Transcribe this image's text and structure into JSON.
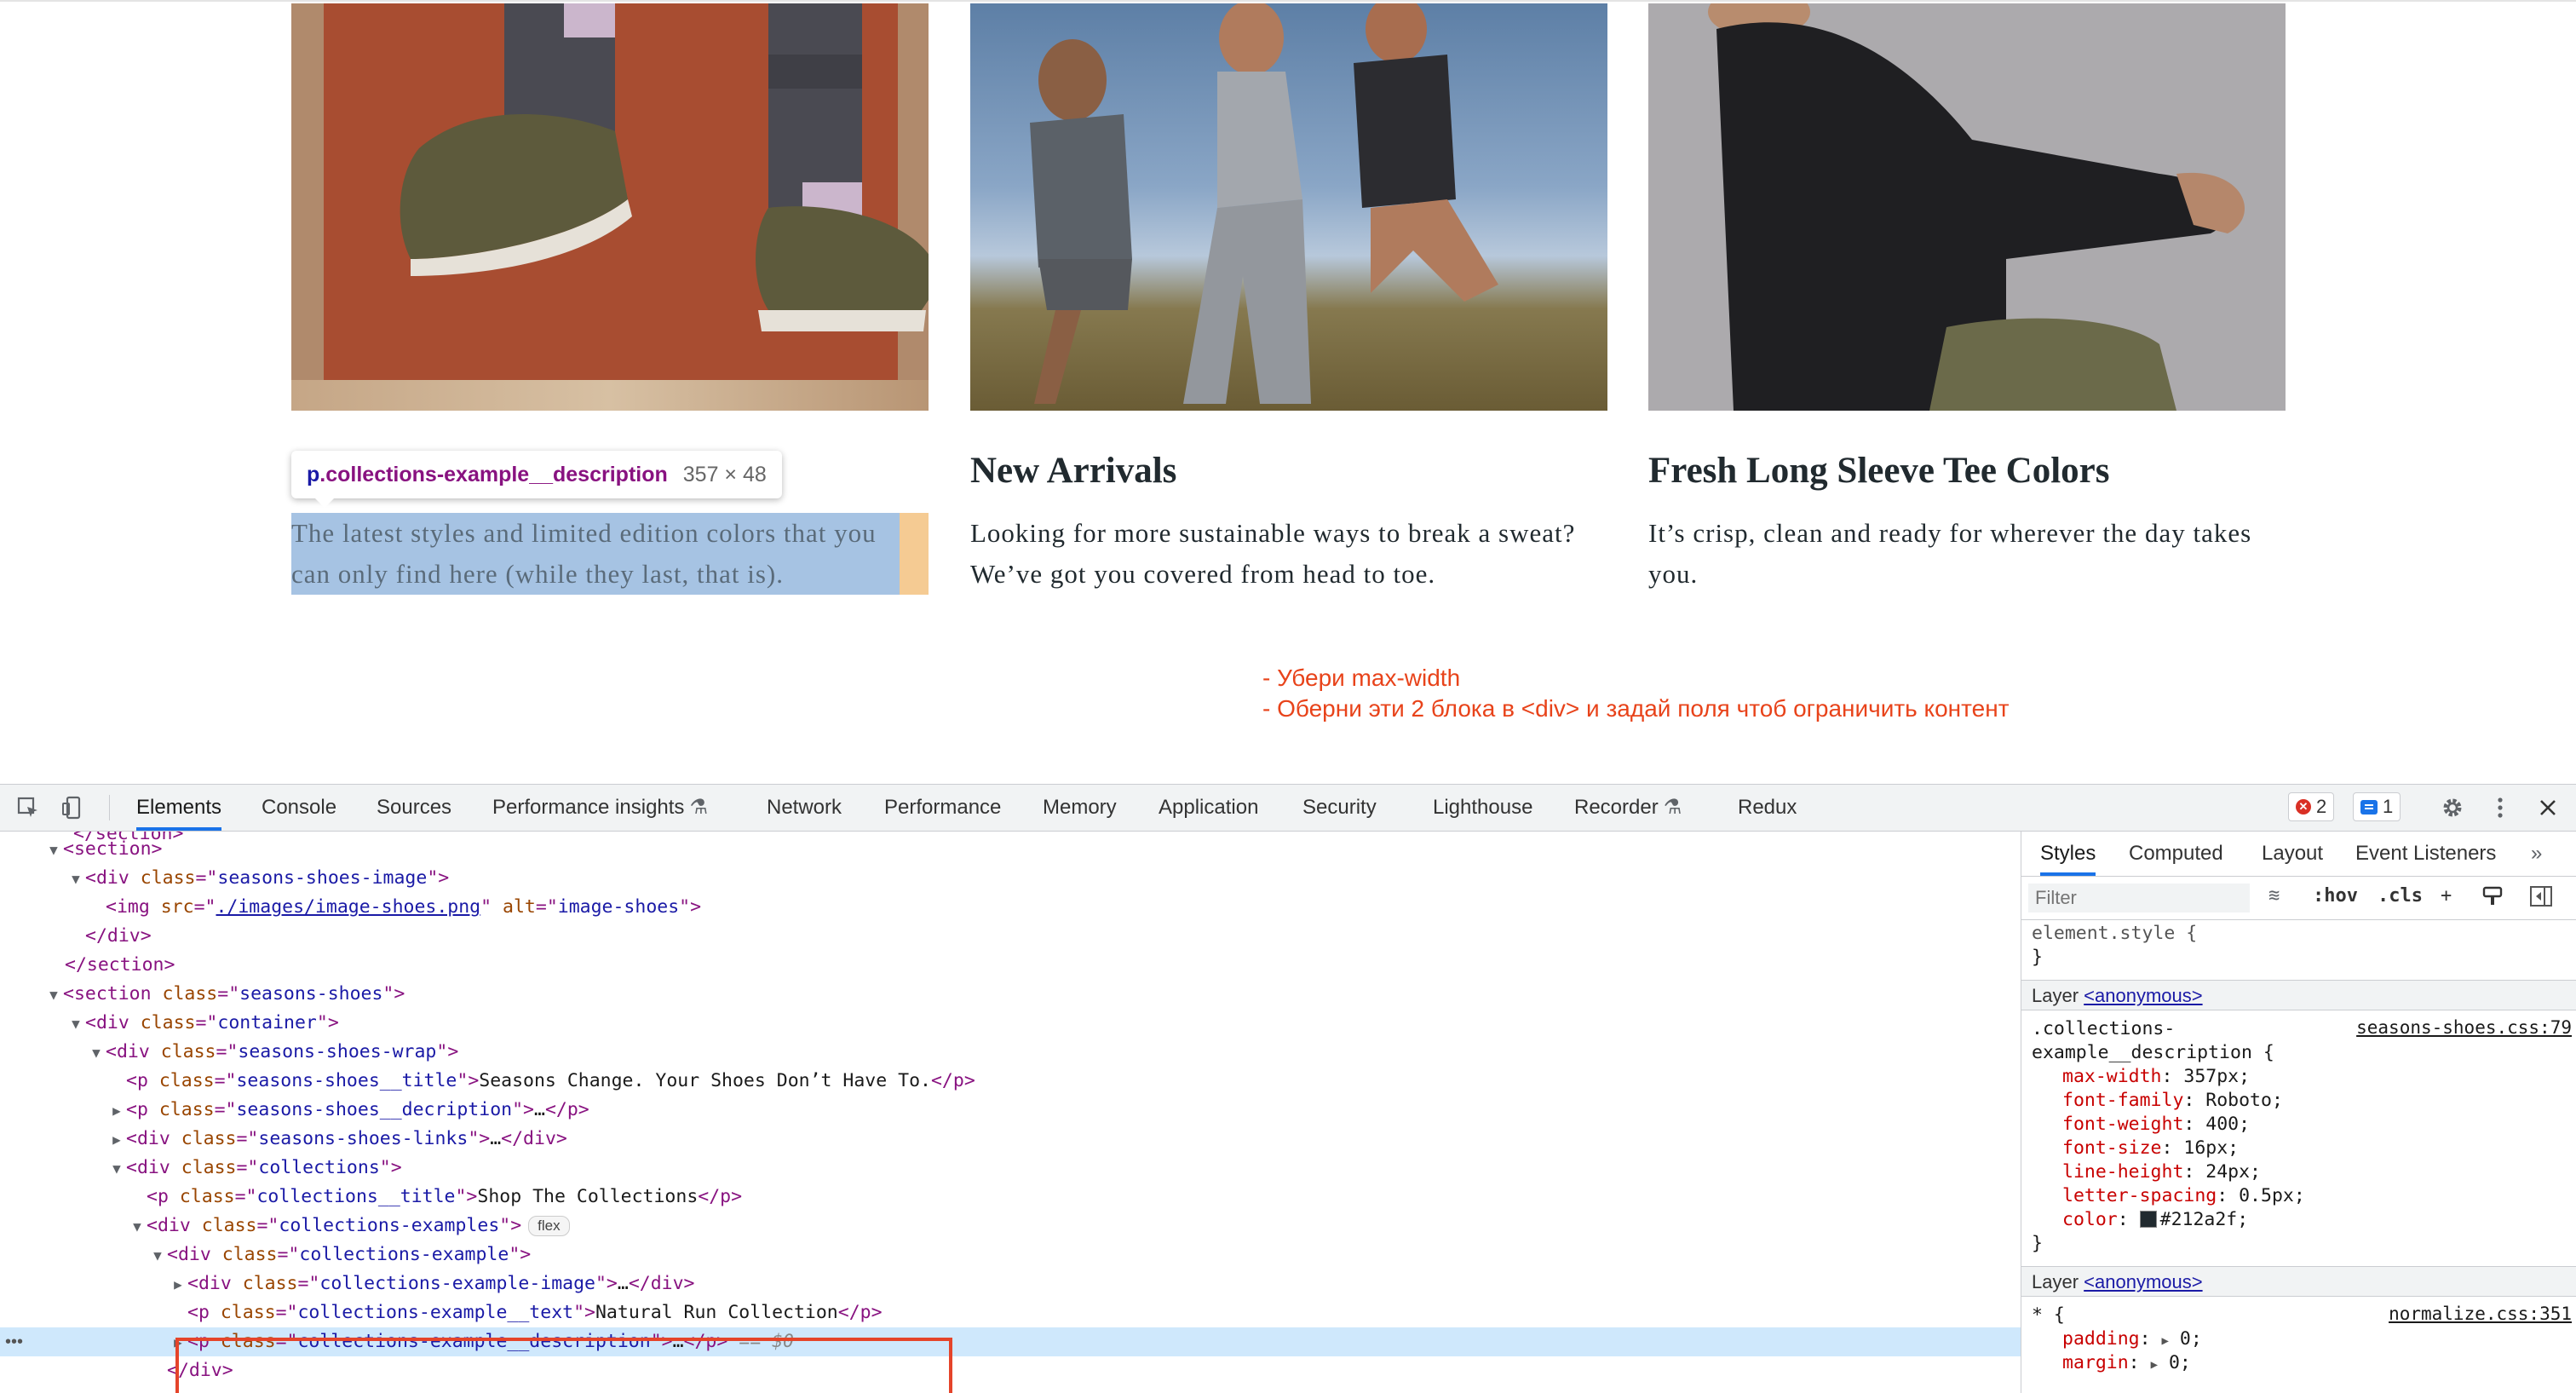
{
  "page": {
    "cards": [
      {
        "image_alt": "Natural Run Collection shoes image",
        "title": "",
        "description": "The latest styles and limited edition colors that you can only find here (while they last, that is)."
      },
      {
        "image_alt": "runners image",
        "title": "New Arrivals",
        "description": "Looking for more sustainable ways to break a sweat? We’ve got you covered from head to toe."
      },
      {
        "image_alt": "long sleeve tee image",
        "title": "Fresh Long Sleeve Tee Colors",
        "description": "It’s crisp, clean and ready for wherever the day takes you."
      }
    ],
    "tooltip": {
      "selector_tag": "p",
      "selector_class": ".collections-example__description",
      "size": "357 × 48"
    },
    "notes": [
      "- Убери max-width",
      "- Оберни эти 2 блока в <div> и задай поля чтоб ограничить контент"
    ]
  },
  "devtools": {
    "tabs": [
      "Elements",
      "Console",
      "Sources",
      "Performance insights",
      "Network",
      "Performance",
      "Memory",
      "Application",
      "Security",
      "Lighthouse",
      "Recorder",
      "Redux"
    ],
    "active_tab": "Elements",
    "error_count": "2",
    "message_count": "1",
    "dom": {
      "l0": "</section>",
      "l1": "<section>",
      "l2": {
        "tag": "div",
        "attr": "class",
        "val": "seasons-shoes-image"
      },
      "l3": {
        "attr1": "src",
        "val1": "./images/image-shoes.png",
        "attr2": "alt",
        "val2": "image-shoes"
      },
      "l4": "</div>",
      "l5": "</section>",
      "l6": {
        "tag": "section",
        "attr": "class",
        "val": "seasons-shoes"
      },
      "l7": {
        "tag": "div",
        "attr": "class",
        "val": "container"
      },
      "l8": {
        "tag": "div",
        "attr": "class",
        "val": "seasons-shoes-wrap"
      },
      "l9": {
        "tag": "p",
        "attr": "class",
        "val": "seasons-shoes__title",
        "text": "Seasons Change. Your Shoes Don’t Have To."
      },
      "l10": {
        "tag": "p",
        "attr": "class",
        "val": "seasons-shoes__decription"
      },
      "l11": {
        "tag": "div",
        "attr": "class",
        "val": "seasons-shoes-links"
      },
      "l12": {
        "tag": "div",
        "attr": "class",
        "val": "collections"
      },
      "l13": {
        "tag": "p",
        "attr": "class",
        "val": "collections__title",
        "text": "Shop The Collections"
      },
      "l14": {
        "tag": "div",
        "attr": "class",
        "val": "collections-examples",
        "badge": "flex"
      },
      "l15": {
        "tag": "div",
        "attr": "class",
        "val": "collections-example"
      },
      "l16": {
        "tag": "div",
        "attr": "class",
        "val": "collections-example-image"
      },
      "l17": {
        "tag": "p",
        "attr": "class",
        "val": "collections-example__text",
        "text": "Natural Run Collection"
      },
      "l18": {
        "tag": "p",
        "attr": "class",
        "val": "collections-example__description",
        "marker": "== $0"
      },
      "l19": "</div>",
      "ellipsis": "…"
    },
    "styles": {
      "tabs": [
        "Styles",
        "Computed",
        "Layout",
        "Event Listeners"
      ],
      "active_tab": "Styles",
      "filter_placeholder": "Filter",
      "hov": ":hov",
      "cls": ".cls",
      "element_style": "element.style {",
      "close_brace": "}",
      "layer_label": "Layer",
      "layer_name": "<anonymous>",
      "rule1": {
        "selector_line1": ".collections-",
        "selector_line2": "example__description {",
        "source": "seasons-shoes.css:79",
        "props": [
          {
            "name": "max-width",
            "value": "357px;"
          },
          {
            "name": "font-family",
            "value": "Roboto;"
          },
          {
            "name": "font-weight",
            "value": "400;"
          },
          {
            "name": "font-size",
            "value": "16px;"
          },
          {
            "name": "line-height",
            "value": "24px;"
          },
          {
            "name": "letter-spacing",
            "value": "0.5px;"
          },
          {
            "name": "color",
            "value": "#212a2f;"
          }
        ]
      },
      "rule2": {
        "selector": "* {",
        "source": "normalize.css:351",
        "props": [
          {
            "name": "padding",
            "value": "0;"
          },
          {
            "name": "margin",
            "value": "0;"
          }
        ]
      }
    }
  },
  "colors": {
    "accent": "#1a73e8",
    "note": "#e8431a",
    "text_dark": "#212a2f",
    "highlight_content": "#a6c3e3",
    "highlight_margin": "#f5cb93"
  }
}
